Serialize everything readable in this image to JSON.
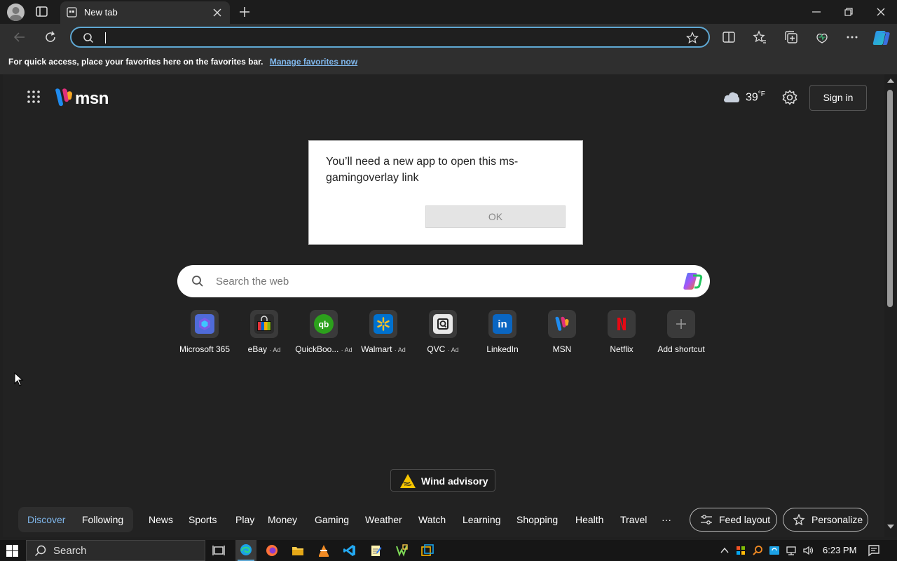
{
  "browser": {
    "tab_title": "New tab",
    "address_value": "",
    "icons": [
      "profile-icon",
      "tab-actions-icon",
      "new-tab-icon",
      "back-icon",
      "refresh-icon",
      "search-icon",
      "favorite-star-icon",
      "split-screen-icon",
      "favorites-icon",
      "collections-icon",
      "browser-essentials-icon",
      "more-icon",
      "copilot-icon",
      "minimize-icon",
      "restore-icon",
      "close-icon"
    ]
  },
  "favorites_bar": {
    "message": "For quick access, place your favorites here on the favorites bar.",
    "link": "Manage favorites now"
  },
  "msn": {
    "logo_text": "msn",
    "weather_temp": "39",
    "weather_unit": "°F",
    "sign_in": "Sign in"
  },
  "dialog": {
    "message": "You’ll need a new app to open this ms-gamingoverlay link",
    "ok": "OK"
  },
  "web_search": {
    "placeholder": "Search the web"
  },
  "shortcuts": [
    {
      "label": "Microsoft 365",
      "ad": "",
      "color": "#4f6bd8"
    },
    {
      "label": "eBay",
      "ad": "· Ad",
      "color": "#e53238"
    },
    {
      "label": "QuickBoo...",
      "ad": "· Ad",
      "color": "#2ca01c"
    },
    {
      "label": "Walmart",
      "ad": "· Ad",
      "color": "#0071ce"
    },
    {
      "label": "QVC",
      "ad": "· Ad",
      "color": "#e8e8e8"
    },
    {
      "label": "LinkedIn",
      "ad": "",
      "color": "#0a66c2"
    },
    {
      "label": "MSN",
      "ad": "",
      "color": "#3a3a3a"
    },
    {
      "label": "Netflix",
      "ad": "",
      "color": "#e50914"
    },
    {
      "label": "Add shortcut",
      "ad": "",
      "color": "#3a3a3a"
    }
  ],
  "advisory": {
    "label": "Wind advisory"
  },
  "nav": {
    "discover": "Discover",
    "following": "Following",
    "items": [
      "News",
      "Sports",
      "Play",
      "Money",
      "Gaming",
      "Weather",
      "Watch",
      "Learning",
      "Shopping",
      "Health",
      "Travel"
    ],
    "more": "···",
    "feed_layout": "Feed layout",
    "personalize": "Personalize"
  },
  "taskbar": {
    "search": "Search",
    "time": "6:23 PM",
    "apps": [
      "task-view-icon",
      "edge-icon",
      "firefox-icon",
      "file-explorer-icon",
      "vlc-icon",
      "vscode-icon",
      "notepad-icon",
      "app-icon",
      "app2-icon"
    ]
  }
}
